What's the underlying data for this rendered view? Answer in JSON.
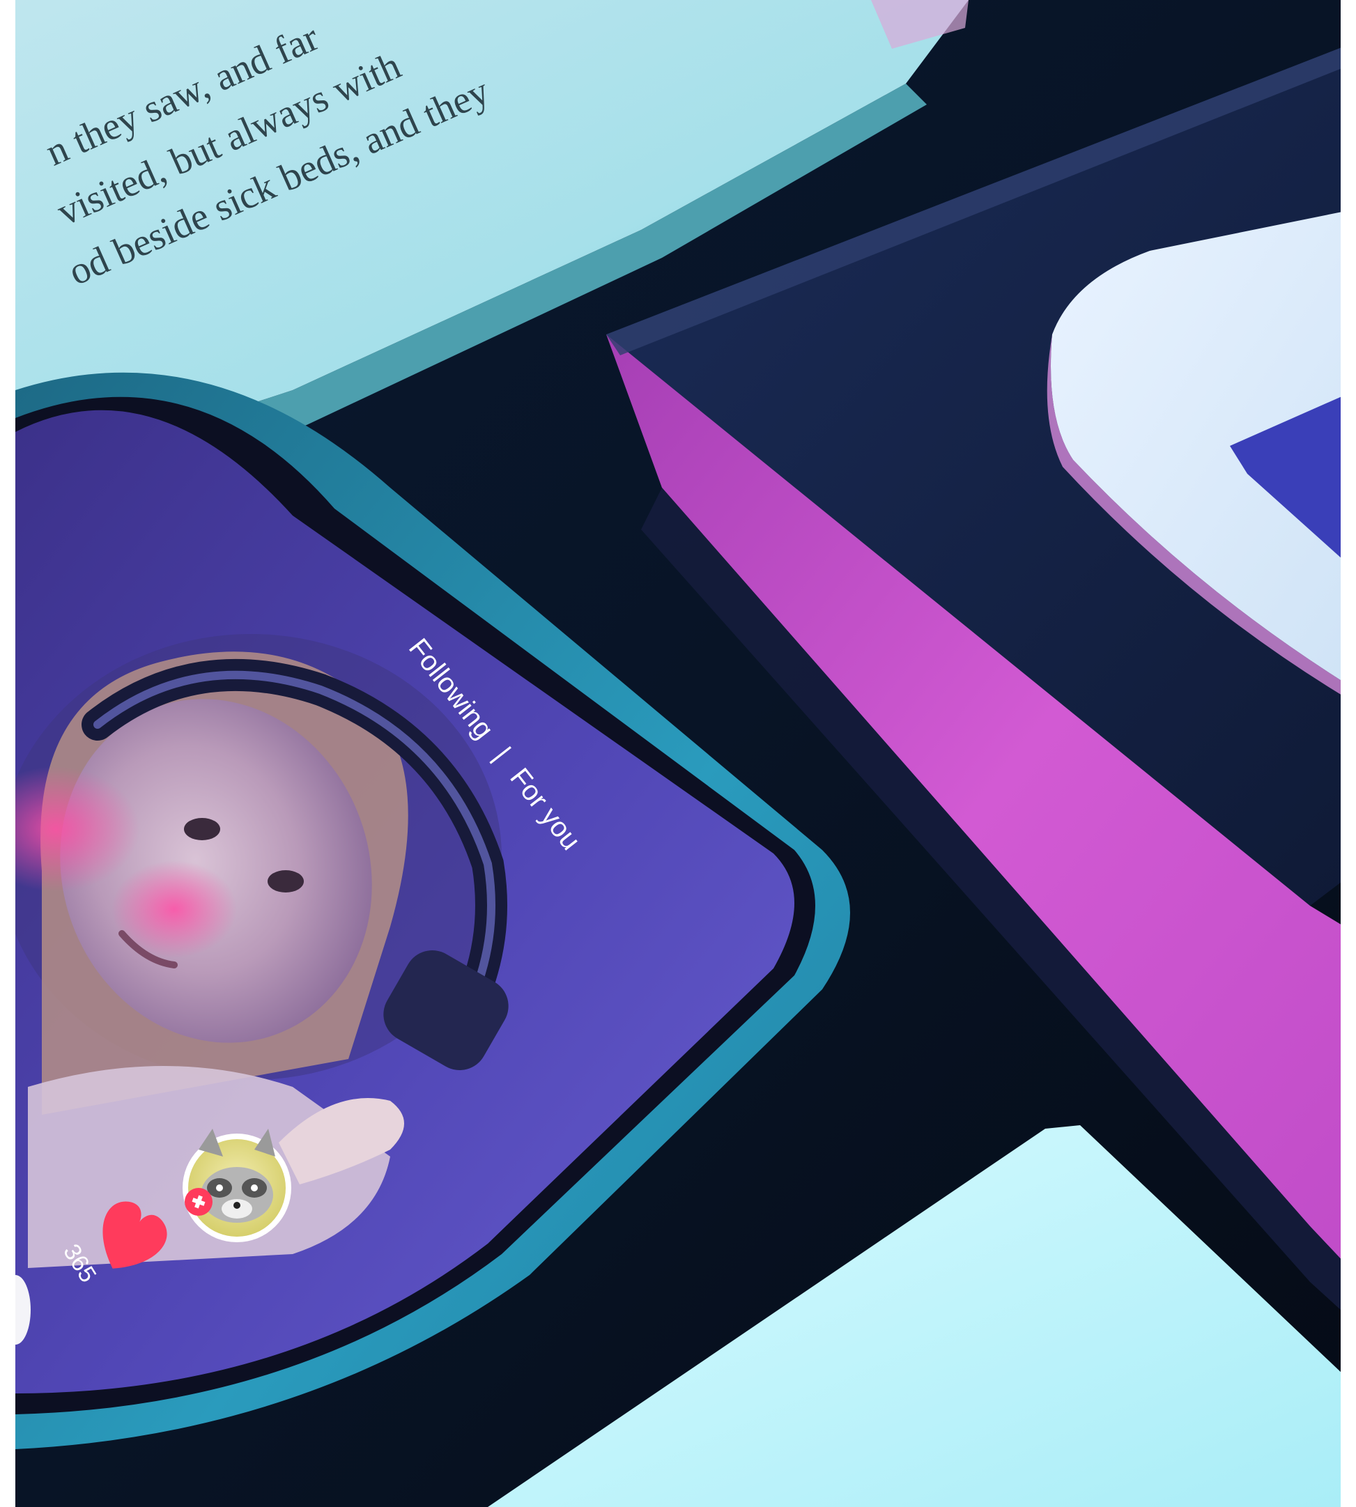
{
  "book_page": {
    "text_lines": [
      "n they saw, and far",
      "visited, but always with",
      "od beside sick beds, and they"
    ]
  },
  "phone": {
    "tabs": {
      "following": "Following",
      "separator": "|",
      "for_you": "For you"
    },
    "like_count": "365",
    "icons": {
      "avatar": "raccoon-avatar-icon",
      "follow": "plus-icon",
      "like": "heart-icon"
    }
  },
  "colors": {
    "screen_top": "#3a2f86",
    "screen_bottom": "#6a5fd1",
    "phone_case": "#2a9bbd",
    "like_red": "#ff3b5c",
    "book_edge_pink": "#d25ad3",
    "book_cover_navy": "#16244a"
  }
}
